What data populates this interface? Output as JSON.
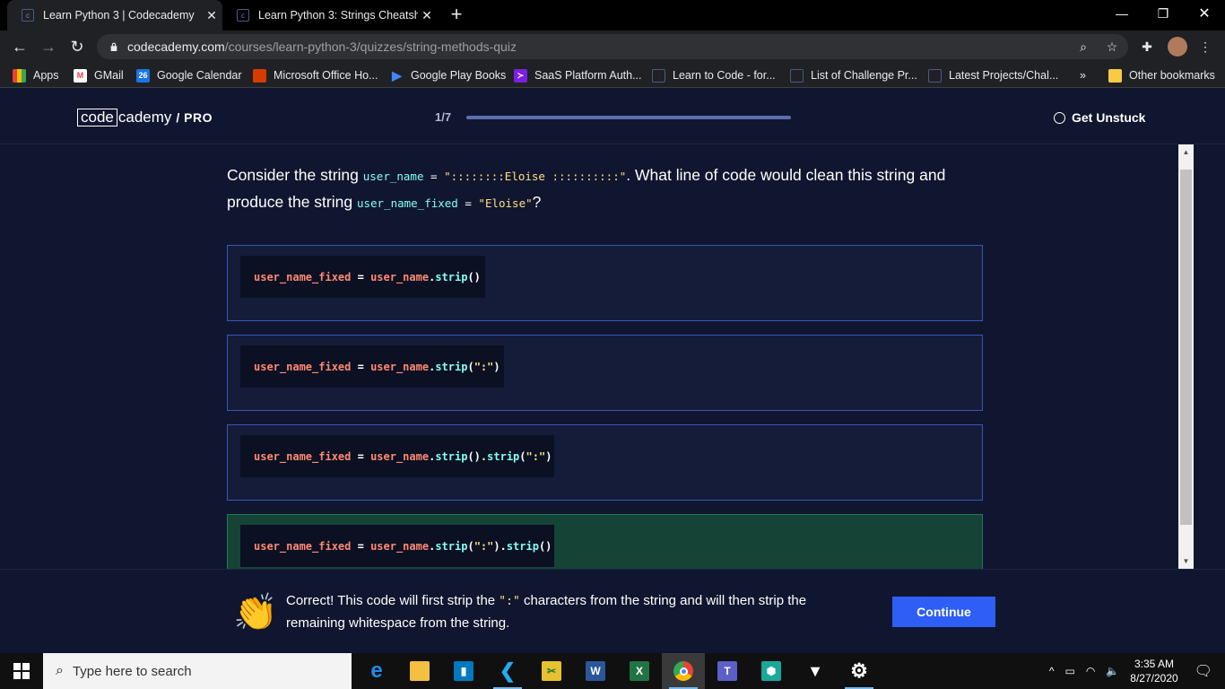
{
  "browser": {
    "tabs": [
      {
        "title": "Learn Python 3 | Codecademy",
        "active": true
      },
      {
        "title": "Learn Python 3: Strings Cheatshe",
        "active": false
      }
    ],
    "url_domain": "codecademy.com",
    "url_path": "/courses/learn-python-3/quizzes/string-methods-quiz",
    "bookmarks": [
      {
        "label": "Apps",
        "icon": "apps-grid-icon"
      },
      {
        "label": "GMail",
        "icon": "gmail-icon"
      },
      {
        "label": "Google Calendar",
        "icon": "calendar-icon",
        "badge": "26"
      },
      {
        "label": "Microsoft Office Ho...",
        "icon": "office-icon"
      },
      {
        "label": "Google Play Books",
        "icon": "play-books-icon"
      },
      {
        "label": "SaaS Platform Auth...",
        "icon": "saas-icon"
      },
      {
        "label": "Learn to Code - for...",
        "icon": "page-icon"
      },
      {
        "label": "List of Challenge Pr...",
        "icon": "page-icon"
      },
      {
        "label": "Latest Projects/Chal...",
        "icon": "page-icon"
      }
    ],
    "overflow_label": "»",
    "other_bookmarks": "Other bookmarks"
  },
  "header": {
    "logo_box": "code",
    "logo_rest": "cademy",
    "logo_pro": "/ PRO",
    "progress_label": "1/7",
    "progress_fraction": 1,
    "help_label": "Get Unstuck"
  },
  "question": {
    "part1": "Consider the string ",
    "code1_var": "user_name",
    "code1_op": " = ",
    "code1_str": "\"::::::::Eloise ::::::::::\"",
    "part2": ". What line of code would clean this string and produce the string ",
    "code2_var": "user_name_fixed",
    "code2_op": " = ",
    "code2_str": "\"Eloise\"",
    "part3": "?"
  },
  "options": [
    {
      "lhs": "user_name_fixed",
      "eq": " = ",
      "obj": "user_name",
      "calls": [
        ".",
        "strip",
        "()"
      ]
    },
    {
      "lhs": "user_name_fixed",
      "eq": " = ",
      "obj": "user_name",
      "calls": [
        ".",
        "strip",
        "(",
        "\":\"",
        ")"
      ]
    },
    {
      "lhs": "user_name_fixed",
      "eq": " = ",
      "obj": "user_name",
      "calls": [
        ".",
        "strip",
        "().",
        "strip",
        "(",
        "\":\"",
        ")"
      ]
    },
    {
      "lhs": "user_name_fixed",
      "eq": " = ",
      "obj": "user_name",
      "calls": [
        ".",
        "strip",
        "(",
        "\":\"",
        ").",
        "strip",
        "()"
      ],
      "state": "correct"
    }
  ],
  "feedback": {
    "text_before": "Correct! This code will first strip the ",
    "code": "\":\"",
    "text_after": " characters from the string and will then strip the remaining whitespace from the string.",
    "continue_label": "Continue"
  },
  "taskbar": {
    "search_placeholder": "Type here to search",
    "time": "3:35 AM",
    "date": "8/27/2020"
  },
  "colors": {
    "page_bg": "#10162f",
    "option_border": "#3a55b8",
    "correct_bg": "#154436",
    "continue_bg": "#2f5ef6",
    "code_var": "#83fff5",
    "code_name": "#ff8973",
    "code_str": "#ffe083"
  }
}
